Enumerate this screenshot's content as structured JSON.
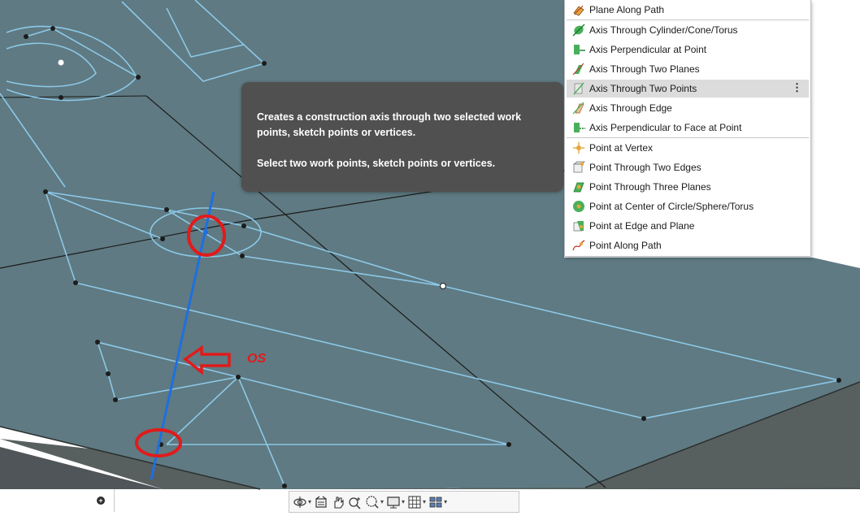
{
  "menu": {
    "items": [
      {
        "label": "Plane Along Path",
        "icon": "plane-along-path-icon"
      },
      {
        "label": "Axis Through Cylinder/Cone/Torus",
        "icon": "axis-cylinder-icon"
      },
      {
        "label": "Axis Perpendicular at Point",
        "icon": "axis-perpendicular-point-icon"
      },
      {
        "label": "Axis Through Two Planes",
        "icon": "axis-two-planes-icon"
      },
      {
        "label": "Axis Through Two Points",
        "icon": "axis-two-points-icon",
        "highlighted": true,
        "more": "⋮"
      },
      {
        "label": "Axis Through Edge",
        "icon": "axis-edge-icon"
      },
      {
        "label": "Axis Perpendicular to Face at Point",
        "icon": "axis-perpendicular-face-icon"
      },
      {
        "label": "Point at Vertex",
        "icon": "point-vertex-icon"
      },
      {
        "label": "Point Through Two Edges",
        "icon": "point-two-edges-icon"
      },
      {
        "label": "Point Through Three Planes",
        "icon": "point-three-planes-icon"
      },
      {
        "label": "Point at Center of Circle/Sphere/Torus",
        "icon": "point-center-icon"
      },
      {
        "label": "Point at Edge and Plane",
        "icon": "point-edge-plane-icon"
      },
      {
        "label": "Point Along Path",
        "icon": "point-along-path-icon"
      }
    ]
  },
  "tooltip": {
    "line1": "Creates a construction axis through two selected work points, sketch points or vertices.",
    "line2": "Select two work points, sketch points or vertices."
  },
  "annotation": {
    "text": "OS"
  },
  "statusfield": {
    "value": "",
    "button_glyph": "+"
  },
  "navbar": {
    "tools": [
      "orbit-icon",
      "view-face-icon",
      "pan-icon",
      "zoom-icon",
      "zoom-window-icon",
      "display-mode-icon",
      "grid-icon",
      "multi-window-icon"
    ]
  },
  "colors": {
    "surface": "#5f7a82",
    "sketch_line": "#8cc8e8",
    "axis_line": "#1e6fe0",
    "markup_red": "#e01b1b",
    "menu_highlight": "#dcdcdc",
    "tooltip_bg": "#505050"
  }
}
